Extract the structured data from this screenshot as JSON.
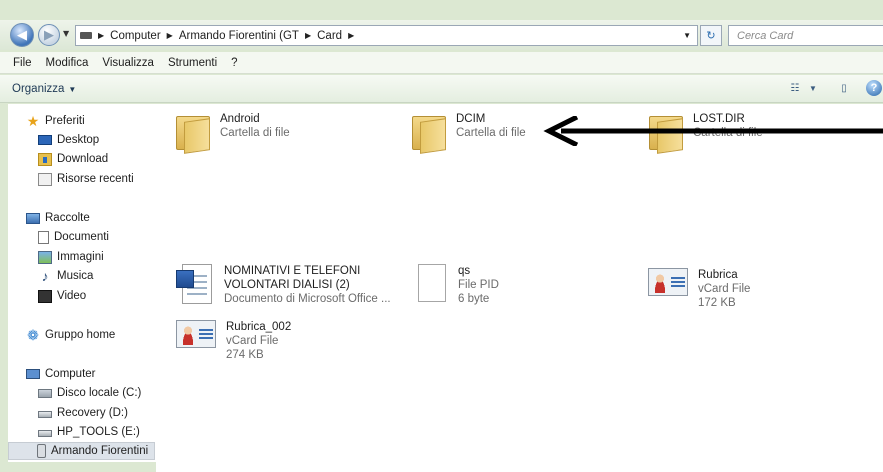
{
  "address": {
    "crumbs": [
      "Computer",
      "Armando Fiorentini (GT",
      "Card"
    ],
    "search_placeholder": "Cerca Card"
  },
  "menu": [
    "File",
    "Modifica",
    "Visualizza",
    "Strumenti",
    "?"
  ],
  "command": {
    "organize": "Organizza"
  },
  "nav": {
    "favorites": {
      "label": "Preferiti",
      "items": [
        "Desktop",
        "Download",
        "Risorse recenti"
      ]
    },
    "libraries": {
      "label": "Raccolte",
      "items": [
        "Documenti",
        "Immagini",
        "Musica",
        "Video"
      ]
    },
    "homegroup": "Gruppo home",
    "computer": {
      "label": "Computer",
      "items": [
        "Disco locale (C:)",
        "Recovery (D:)",
        "HP_TOOLS (E:)",
        "Armando Fiorentini"
      ]
    }
  },
  "files": [
    {
      "name": "Android",
      "type": "Cartella di file"
    },
    {
      "name": "DCIM",
      "type": "Cartella di file"
    },
    {
      "name": "LOST.DIR",
      "type": "Cartella di file"
    },
    {
      "name_line1": "NOMINATIVI E TELEFONI",
      "name_line2": "VOLONTARI DIALISI (2)",
      "type": "Documento di Microsoft Office ..."
    },
    {
      "name": "qs",
      "type": "File PID",
      "size": "6 byte"
    },
    {
      "name": "Rubrica",
      "type": "vCard File",
      "size": "172 KB"
    },
    {
      "name": "Rubrica_002",
      "type": "vCard File",
      "size": "274 KB"
    }
  ],
  "icons": {
    "back": "back-arrow-icon",
    "forward": "forward-arrow-icon",
    "refresh": "refresh-icon",
    "help": "help-icon",
    "folder": "folder-icon",
    "vcard": "vcard-icon",
    "document": "document-icon"
  },
  "colors": {
    "window_frame": "#dce8d2",
    "selected_nav": "#dde3ea",
    "annotation_arrow": "#000000"
  }
}
